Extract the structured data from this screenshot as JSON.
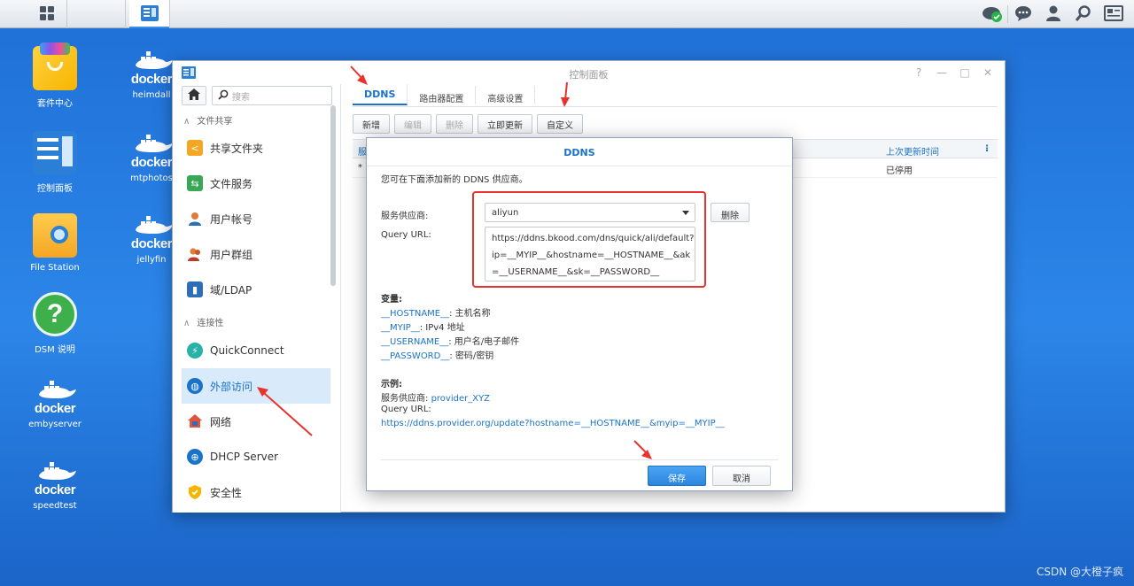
{
  "taskbar": {
    "right_icons": [
      "cloud-sync-icon",
      "chat-icon",
      "user-icon",
      "search-icon",
      "widgets-icon"
    ]
  },
  "desktop": {
    "icons": [
      {
        "label": "套件中心",
        "icon": "package-center-icon"
      },
      {
        "label": "控制面板",
        "icon": "control-panel-icon"
      },
      {
        "label": "File Station",
        "icon": "folder-search-icon"
      },
      {
        "label": "DSM 说明",
        "icon": "help-icon"
      },
      {
        "label": "embyserver",
        "icon": "docker-icon"
      },
      {
        "label": "speedtest",
        "icon": "docker-icon"
      },
      {
        "label": "heimdall",
        "icon": "docker-icon"
      },
      {
        "label": "mtphotos",
        "icon": "docker-icon"
      },
      {
        "label": "jellyfin",
        "icon": "docker-icon"
      }
    ],
    "docker_word": "docker"
  },
  "window": {
    "title": "控制面板",
    "controls": [
      "?",
      "—",
      "□",
      "✕"
    ]
  },
  "sidebar": {
    "search_placeholder": "搜索",
    "sections": [
      {
        "label": "文件共享"
      },
      {
        "label": "连接性"
      }
    ],
    "items": [
      {
        "label": "共享文件夹",
        "color": "#f5a623"
      },
      {
        "label": "文件服务",
        "color": "#3aa757"
      },
      {
        "label": "用户帐号",
        "color": "#e07b39"
      },
      {
        "label": "用户群组",
        "color": "#e07b39"
      },
      {
        "label": "域/LDAP",
        "color": "#2d6fb7"
      },
      {
        "label": "QuickConnect",
        "color": "#26b3a6"
      },
      {
        "label": "外部访问",
        "color": "#1a73c9"
      },
      {
        "label": "网络",
        "color": "#e0533d"
      },
      {
        "label": "DHCP Server",
        "color": "#1a73c9"
      },
      {
        "label": "安全性",
        "color": "#f5b400"
      }
    ]
  },
  "main": {
    "tabs": [
      "DDNS",
      "路由器配置",
      "高级设置"
    ],
    "toolbar": [
      "新增",
      "编辑",
      "删除",
      "立即更新",
      "自定义"
    ],
    "grid": {
      "col_first": "服",
      "col_last_update": "上次更新时间",
      "menu": "⁝",
      "row_first": "*",
      "row_last_update": "已停用"
    }
  },
  "dialog": {
    "title": "DDNS",
    "description": "您可在下面添加新的 DDNS 供应商。",
    "provider_label": "服务供应商:",
    "provider_value": "aliyun",
    "delete_label": "删除",
    "query_url_label": "Query URL:",
    "query_url_lines": [
      "https://ddns.bkood.com/dns/quick/ali/default?",
      "ip=__MYIP__&hostname=__HOSTNAME__&ak",
      "=__USERNAME__&sk=__PASSWORD__"
    ],
    "variables_title": "变量:",
    "variables": [
      {
        "key": "__HOSTNAME__",
        "desc": ": 主机名称"
      },
      {
        "key": "__MYIP__",
        "desc": ": IPv4 地址"
      },
      {
        "key": "__USERNAME__",
        "desc": ": 用户名/电子邮件"
      },
      {
        "key": "__PASSWORD__",
        "desc": ": 密码/密钥"
      }
    ],
    "example_title": "示例:",
    "example_provider_label": "服务供应商: ",
    "example_provider_value": "provider_XYZ",
    "example_query_label": "Query URL:",
    "example_query_value": "https://ddns.provider.org/update?hostname=__HOSTNAME__&myip=__MYIP__",
    "save_label": "保存",
    "cancel_label": "取消"
  },
  "watermark": "CSDN @大橙子疯",
  "colors": {
    "accent": "#1a73c9",
    "annotation_red": "#e8322d"
  }
}
